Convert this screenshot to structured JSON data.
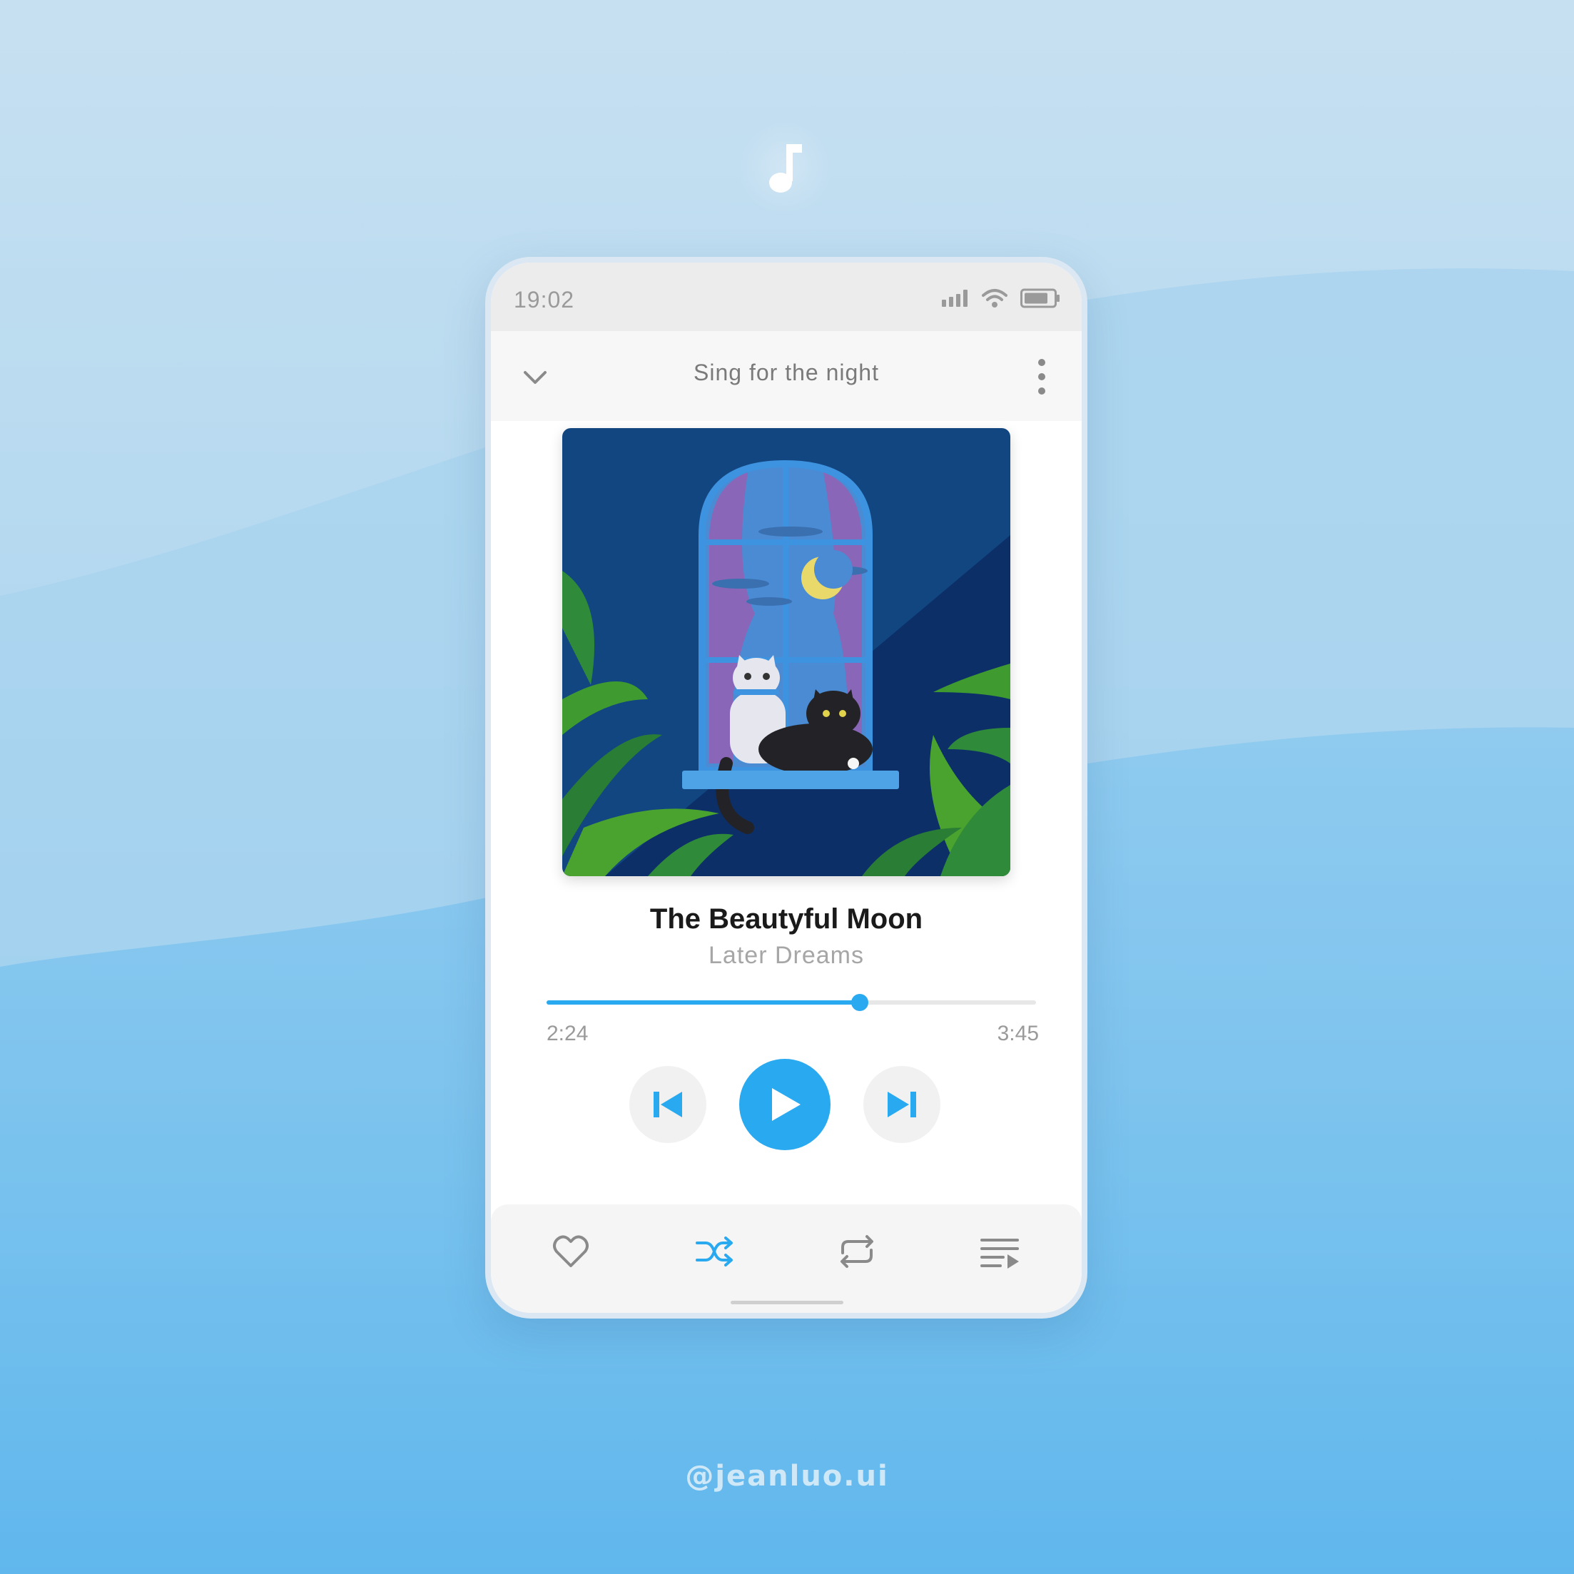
{
  "status": {
    "time": "19:02"
  },
  "header": {
    "playlist_title": "Sing for the night"
  },
  "track": {
    "title": "The Beautyful Moon",
    "artist": "Later Dreams"
  },
  "playback": {
    "current_time": "2:24",
    "total_time": "3:45",
    "progress_fraction": 0.64,
    "is_playing": false
  },
  "bottom_bar": {
    "items": [
      "heart-icon",
      "shuffle-icon",
      "repeat-icon",
      "queue-icon"
    ],
    "shuffle_active": true
  },
  "footer": {
    "handle": "@jeanluo.ui"
  },
  "colors": {
    "accent": "#29a9ef",
    "muted": "#9a9a9a",
    "title": "#1a1a1a",
    "art_background": "#124680"
  }
}
